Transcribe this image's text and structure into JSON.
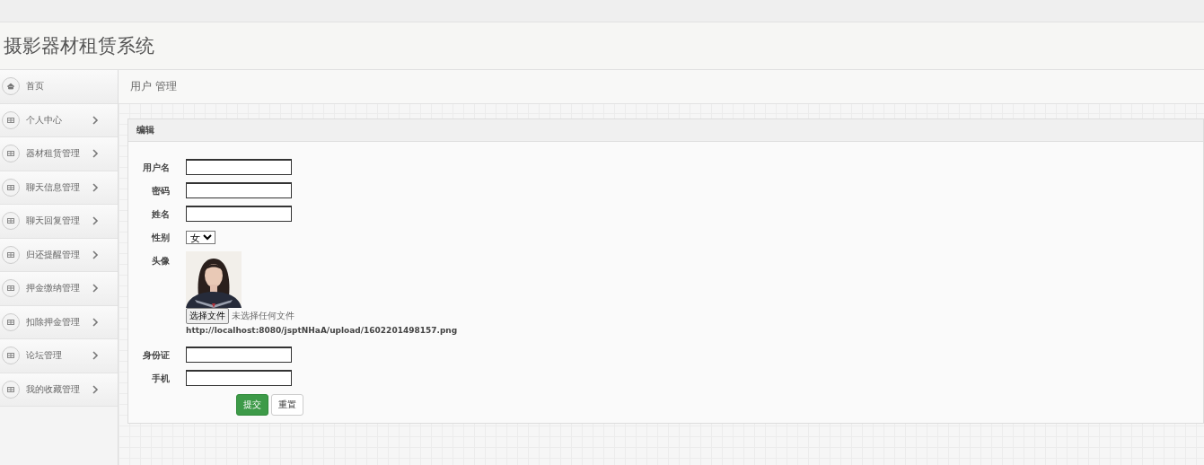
{
  "header": {
    "title": "摄影器材租赁系统"
  },
  "sidebar": {
    "items": [
      {
        "label": "首页",
        "kind": "home"
      },
      {
        "label": "个人中心",
        "kind": "menu"
      },
      {
        "label": "器材租赁管理",
        "kind": "menu"
      },
      {
        "label": "聊天信息管理",
        "kind": "menu"
      },
      {
        "label": "聊天回复管理",
        "kind": "menu"
      },
      {
        "label": "归还提醒管理",
        "kind": "menu"
      },
      {
        "label": "押金缴纳管理",
        "kind": "menu"
      },
      {
        "label": "扣除押金管理",
        "kind": "menu"
      },
      {
        "label": "论坛管理",
        "kind": "menu"
      },
      {
        "label": "我的收藏管理",
        "kind": "menu"
      }
    ]
  },
  "breadcrumb": "用户 管理",
  "panel": {
    "title": "编辑",
    "fields": [
      {
        "label": "用户名",
        "kind": "text"
      },
      {
        "label": "密码",
        "kind": "text"
      },
      {
        "label": "姓名",
        "kind": "text"
      },
      {
        "label": "性别",
        "kind": "select",
        "value": "女"
      },
      {
        "label": "头像",
        "file_button": "选择文件",
        "file_status": "未选择任何文件",
        "url": "http://localhost:8080/jsptNHaA/upload/1602201498157.png"
      },
      {
        "label": "身份证",
        "kind": "text"
      },
      {
        "label": "手机",
        "kind": "text"
      }
    ],
    "buttons": [
      {
        "label": "提交",
        "kind": "primary"
      },
      {
        "label": "重置",
        "kind": "default"
      }
    ]
  }
}
